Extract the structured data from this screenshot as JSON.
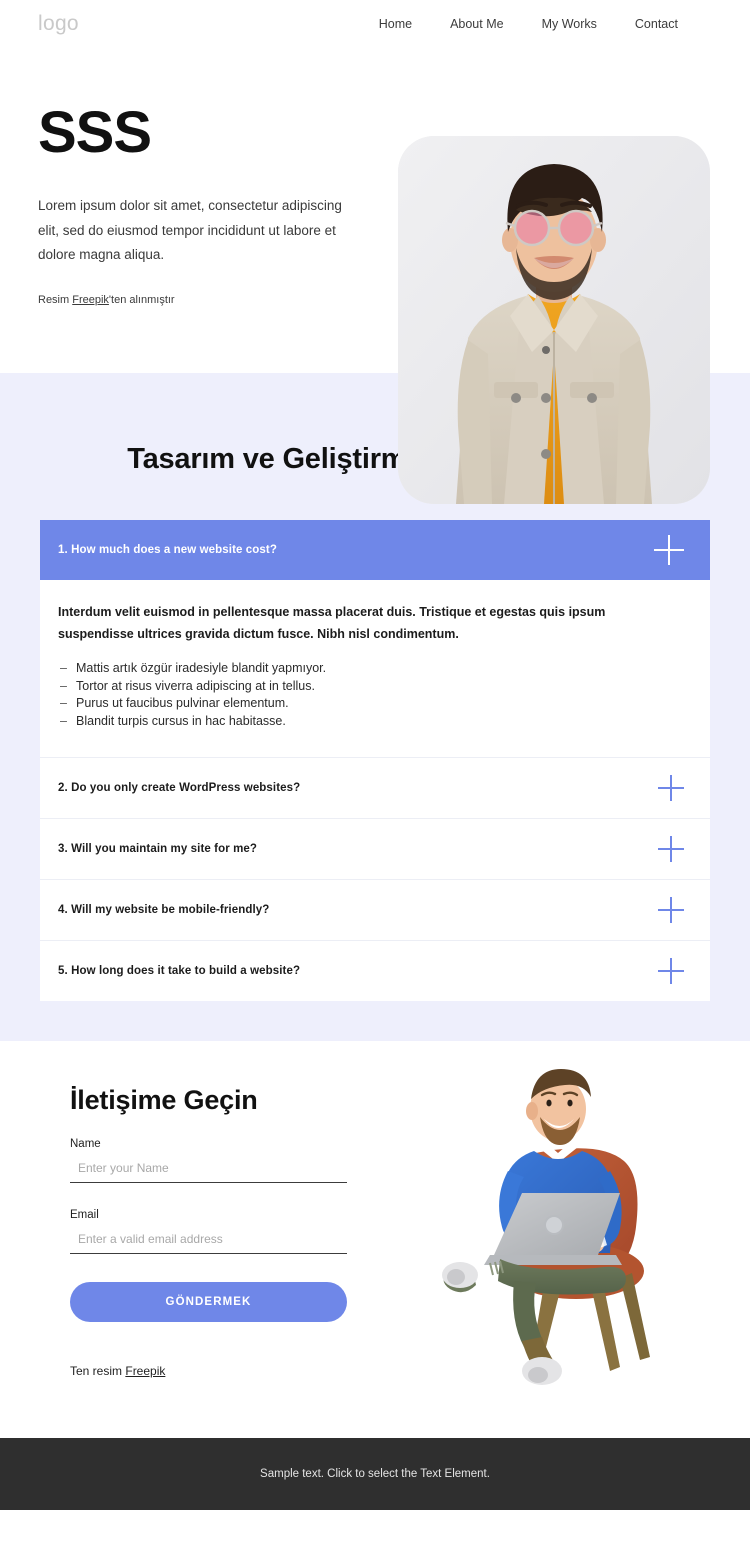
{
  "header": {
    "logo": "logo",
    "nav": [
      {
        "label": "Home"
      },
      {
        "label": "About Me"
      },
      {
        "label": "My Works"
      },
      {
        "label": "Contact"
      }
    ]
  },
  "hero": {
    "title": "SSS",
    "description": "Lorem ipsum dolor sit amet, consectetur adipiscing elit, sed do eiusmod tempor incididunt ut labore et dolore magna aliqua.",
    "credit_prefix": "Resim ",
    "credit_link": "Freepik",
    "credit_suffix": "'ten alınmıştır",
    "photo_alt": "smiling-man-in-sunglasses-photo"
  },
  "faq": {
    "title": "Tasarım ve Geliştirme Hakkında SSS",
    "items": [
      {
        "question": "1. How much does a new website cost?",
        "open": true,
        "lead": "Interdum velit euismod in pellentesque massa placerat duis. Tristique et egestas quis ipsum suspendisse ultrices gravida dictum fusce. Nibh nisl condimentum.",
        "bullets": [
          "Mattis artık özgür iradesiyle blandit yapmıyor.",
          "Tortor at risus viverra adipiscing at in tellus.",
          "Purus ut faucibus pulvinar elementum.",
          "Blandit turpis cursus in hac habitasse."
        ]
      },
      {
        "question": "2. Do you only create WordPress websites?",
        "open": false
      },
      {
        "question": "3. Will you maintain my site for me?",
        "open": false
      },
      {
        "question": "4. Will my website be mobile-friendly?",
        "open": false
      },
      {
        "question": "5. How long does it take to build a website?",
        "open": false
      }
    ]
  },
  "contact": {
    "title": "İletişime Geçin",
    "name_label": "Name",
    "name_placeholder": "Enter your Name",
    "name_value": "",
    "email_label": "Email",
    "email_placeholder": "Enter a valid email address",
    "email_value": "",
    "submit_label": "GÖNDERMEK",
    "credit_prefix": "Ten resim ",
    "credit_link": "Freepik",
    "illustration_alt": "3d-character-with-laptop-in-armchair"
  },
  "footer": {
    "text": "Sample text. Click to select the Text Element."
  },
  "colors": {
    "accent": "#6f87e8",
    "section_bg": "#eeeffc",
    "footer_bg": "#2f2f2f",
    "page_bg": "#ffffff"
  }
}
